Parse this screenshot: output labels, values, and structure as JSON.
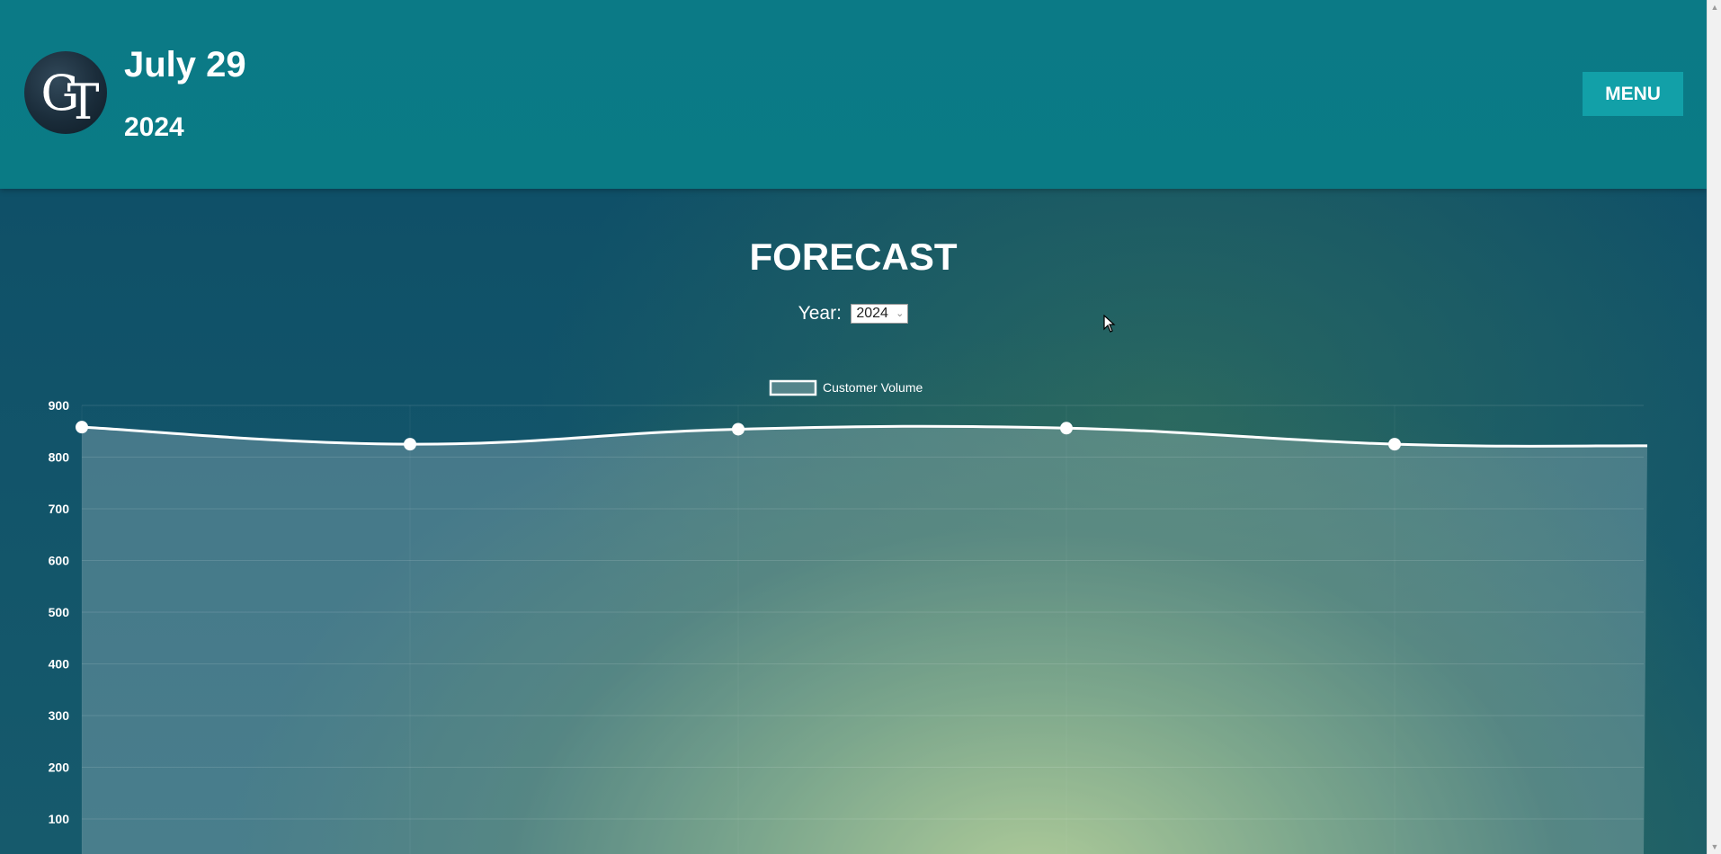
{
  "header": {
    "logo_text": "GT",
    "date_month_day": "July 29",
    "date_year": "2024",
    "menu_label": "MENU"
  },
  "main": {
    "title": "FORECAST",
    "year_label": "Year:",
    "year_selected": "2024"
  },
  "chart_data": {
    "type": "line",
    "series": [
      {
        "name": "Customer Volume",
        "x": [
          0,
          1,
          2,
          3,
          4,
          4.77
        ],
        "values": [
          858,
          825,
          854,
          856,
          825,
          822
        ]
      }
    ],
    "y_ticks": [
      100,
      200,
      300,
      400,
      500,
      600,
      700,
      800,
      900
    ],
    "ylim": [
      0,
      900
    ],
    "legend": "top-center",
    "grid": true,
    "fill": true
  },
  "colors": {
    "header_bg": "#0b7a86",
    "menu_button": "#12a0a8",
    "line": "#ffffff"
  },
  "icons": {
    "cursor": "cursor-arrow-icon",
    "scroll_up": "scroll-up-arrow-icon",
    "scroll_down": "scroll-down-arrow-icon"
  }
}
